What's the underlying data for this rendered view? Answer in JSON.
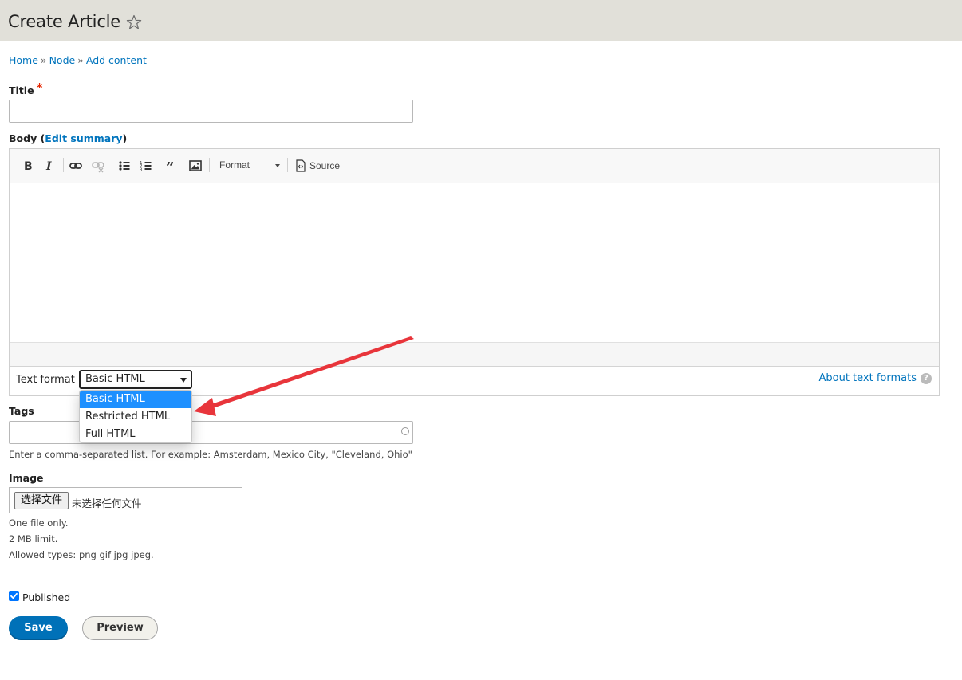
{
  "header": {
    "title": "Create Article"
  },
  "breadcrumb": {
    "items": [
      "Home",
      "Node",
      "Add content"
    ],
    "separator": "»"
  },
  "title_field": {
    "label": "Title",
    "required_mark": "*",
    "value": ""
  },
  "body_field": {
    "label": "Body",
    "paren_open": "(",
    "edit_summary": "Edit summary",
    "paren_close": ")",
    "toolbar": {
      "format_label": "Format",
      "source_label": "Source"
    },
    "text_format": {
      "label": "Text format",
      "selected": "Basic HTML",
      "options": [
        "Basic HTML",
        "Restricted HTML",
        "Full HTML"
      ],
      "about_link": "About text formats",
      "help_glyph": "?"
    }
  },
  "tags_field": {
    "label": "Tags",
    "value": "",
    "description": "Enter a comma-separated list. For example: Amsterdam, Mexico City, \"Cleveland, Ohio\""
  },
  "image_field": {
    "label": "Image",
    "choose_button": "选择文件",
    "no_file_text": "未选择任何文件",
    "descriptions": [
      "One file only.",
      "2 MB limit.",
      "Allowed types: png gif jpg jpeg."
    ]
  },
  "published": {
    "label": "Published",
    "checked": true
  },
  "actions": {
    "save": "Save",
    "preview": "Preview"
  },
  "colors": {
    "link": "#0074bd",
    "primary_button": "#0071b8",
    "annotation_arrow": "#e8353b",
    "selected_option": "#1e90ff"
  }
}
